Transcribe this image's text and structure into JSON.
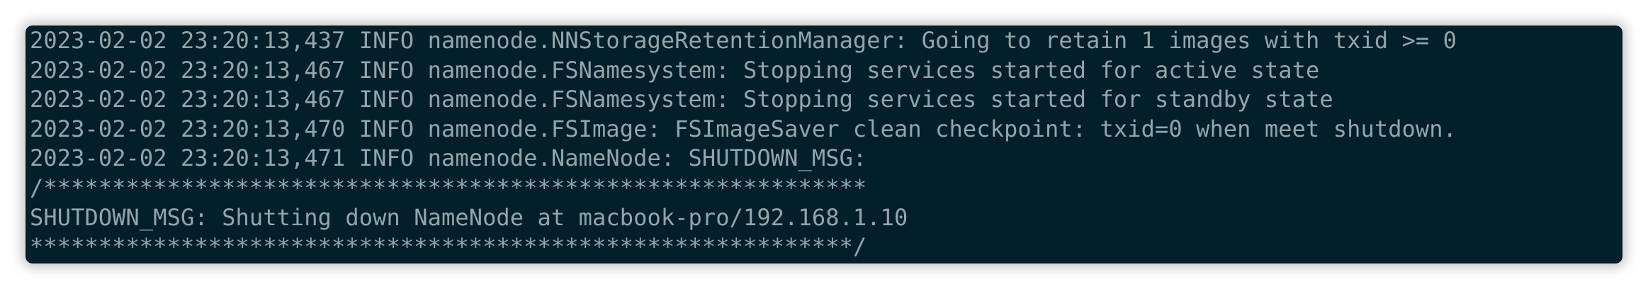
{
  "terminal": {
    "lines": [
      "2023-02-02 23:20:13,437 INFO namenode.NNStorageRetentionManager: Going to retain 1 images with txid >= 0",
      "2023-02-02 23:20:13,467 INFO namenode.FSNamesystem: Stopping services started for active state",
      "2023-02-02 23:20:13,467 INFO namenode.FSNamesystem: Stopping services started for standby state",
      "2023-02-02 23:20:13,470 INFO namenode.FSImage: FSImageSaver clean checkpoint: txid=0 when meet shutdown.",
      "2023-02-02 23:20:13,471 INFO namenode.NameNode: SHUTDOWN_MSG:",
      "/************************************************************",
      "SHUTDOWN_MSG: Shutting down NameNode at macbook-pro/192.168.1.10",
      "************************************************************/"
    ]
  },
  "colors": {
    "background": "#03202a",
    "text": "#94a4ac"
  }
}
